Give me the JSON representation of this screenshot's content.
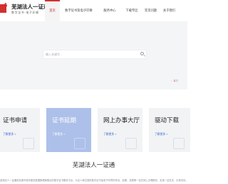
{
  "header": {
    "logo_text": "A",
    "site_name": "芜湖法人一证通",
    "site_sub": "数字证书·电子印章"
  },
  "nav": {
    "items": [
      {
        "label": "首页",
        "active": true
      },
      {
        "label": "数字证书及电子印章",
        "active": false
      },
      {
        "label": "服务中心",
        "active": false
      },
      {
        "label": "下载专区",
        "active": false
      },
      {
        "label": "常见问题",
        "active": false
      },
      {
        "label": "关于我们",
        "active": false
      }
    ]
  },
  "search": {
    "placeholder": "输入关键字..."
  },
  "pager": {
    "prev": "‹",
    "current": "1",
    "separator": "/",
    "total": "2"
  },
  "cards": [
    {
      "title": "证书申请",
      "link": "了解更多 >",
      "highlighted": false
    },
    {
      "title": "证书延期",
      "link": "了解更多 >",
      "highlighted": true
    },
    {
      "title": "网上办事大厅",
      "link": "了解更多 >",
      "highlighted": false
    },
    {
      "title": "驱动下载",
      "link": "了解更多 >",
      "highlighted": false
    }
  ],
  "section": {
    "title": "芜湖法人一证通"
  },
  "footer": {
    "text": "芜湖法人一证通是芜湖市政务服务数据管理局推出的数字证书服务平台，为法人单位提供数字证书及电子印章的申请、延期、变更等一站式网上办理服务，实现一证在手，办事无忧。"
  },
  "colors": {
    "accent": "#d2312f",
    "card_highlight": "#adc0e9",
    "link": "#3c6bd4"
  }
}
